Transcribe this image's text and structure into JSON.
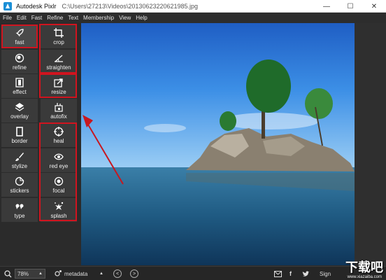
{
  "window": {
    "app_name": "Autodesk Pixlr",
    "file_path": "C:\\Users\\27213\\Videos\\20130623220621985.jpg",
    "minimize": "—",
    "maximize": "☐",
    "close": "✕"
  },
  "menu": [
    "File",
    "Edit",
    "Fast",
    "Refine",
    "Text",
    "Membership",
    "View",
    "Help"
  ],
  "tools_left": [
    {
      "label": "fast",
      "icon": "rocket-icon",
      "selected": true
    },
    {
      "label": "refine",
      "icon": "refine-icon"
    },
    {
      "label": "effect",
      "icon": "film-icon"
    },
    {
      "label": "overlay",
      "icon": "layers-icon"
    },
    {
      "label": "border",
      "icon": "border-icon"
    },
    {
      "label": "stylize",
      "icon": "brush-icon"
    },
    {
      "label": "stickers",
      "icon": "sticker-icon"
    },
    {
      "label": "type",
      "icon": "quote-icon"
    }
  ],
  "tools_right": [
    {
      "label": "crop",
      "icon": "crop-icon"
    },
    {
      "label": "straighten",
      "icon": "straighten-icon"
    },
    {
      "label": "resize",
      "icon": "resize-icon"
    },
    {
      "label": "autofix",
      "icon": "autofix-icon"
    },
    {
      "label": "heal",
      "icon": "heal-icon"
    },
    {
      "label": "red eye",
      "icon": "eye-icon"
    },
    {
      "label": "focal",
      "icon": "focal-icon"
    },
    {
      "label": "splash",
      "icon": "splash-icon"
    }
  ],
  "bottom": {
    "zoom": "78%",
    "zoom_caret": "▲",
    "metadata_label": "metadata",
    "metadata_caret": "▲",
    "prev": "<",
    "next": ">",
    "facebook": "f",
    "sign": "Sign"
  },
  "watermark": {
    "main": "下载吧",
    "sub": "www.xiazaiba.com"
  },
  "colors": {
    "highlight": "#d0141f",
    "panel": "#3a3a3a",
    "background": "#2b2b2b"
  }
}
